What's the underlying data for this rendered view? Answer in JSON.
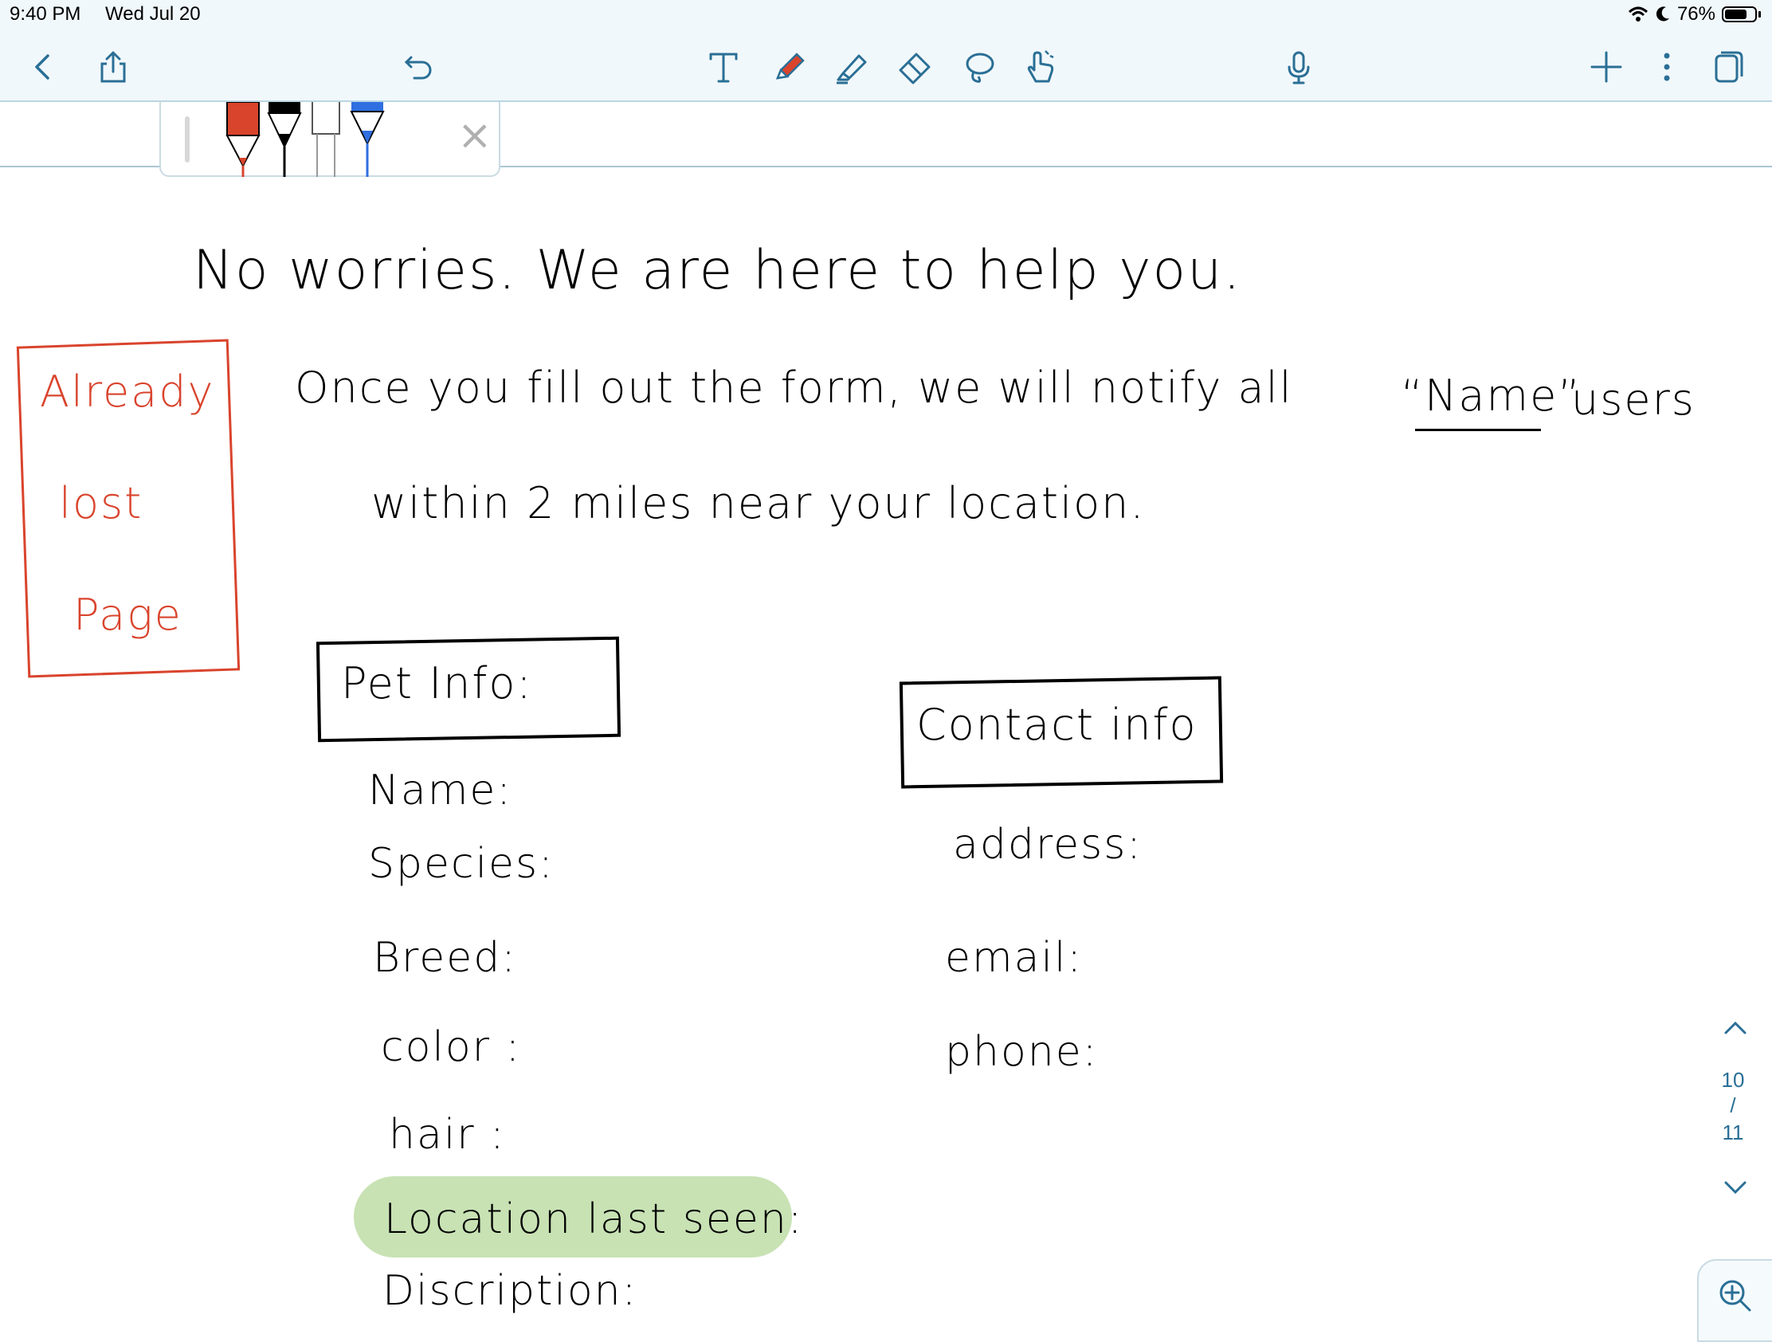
{
  "status_bar": {
    "time": "9:40 PM",
    "date": "Wed Jul 20",
    "battery_percent": "76%",
    "battery_level": 0.76
  },
  "toolbar": {
    "icons": [
      "back-icon",
      "share-icon",
      "undo-icon",
      "text-tool-icon",
      "pen-tool-icon",
      "highlighter-icon",
      "eraser-icon",
      "lasso-icon",
      "hand-pointer-icon",
      "microphone-icon",
      "add-icon",
      "more-icon",
      "pages-icon"
    ],
    "accent": "#2a6f96"
  },
  "pen_tray": {
    "colors": [
      "#d9442d",
      "#000000",
      "#ffffff",
      "#2f6fe0"
    ],
    "close": "×"
  },
  "note": {
    "line1": "No worries. We are here to help you.",
    "line2_a": "Once you fill out the form, we will notify all",
    "line2_b": "“Name”",
    "line2_c": "users",
    "line3": "within 2 miles near your location.",
    "side_note": [
      "Already",
      "lost",
      "Page"
    ],
    "pet_info_title": "Pet Info:",
    "pet_fields": [
      "Name:",
      "Species:",
      "Breed:",
      "color :",
      "hair :",
      "Location last seen:",
      "Discription:"
    ],
    "contact_title": "Contact info",
    "contact_fields": [
      "address:",
      "email:",
      "phone:"
    ]
  },
  "page_nav": {
    "current": "10",
    "separator": "/",
    "total": "11"
  }
}
